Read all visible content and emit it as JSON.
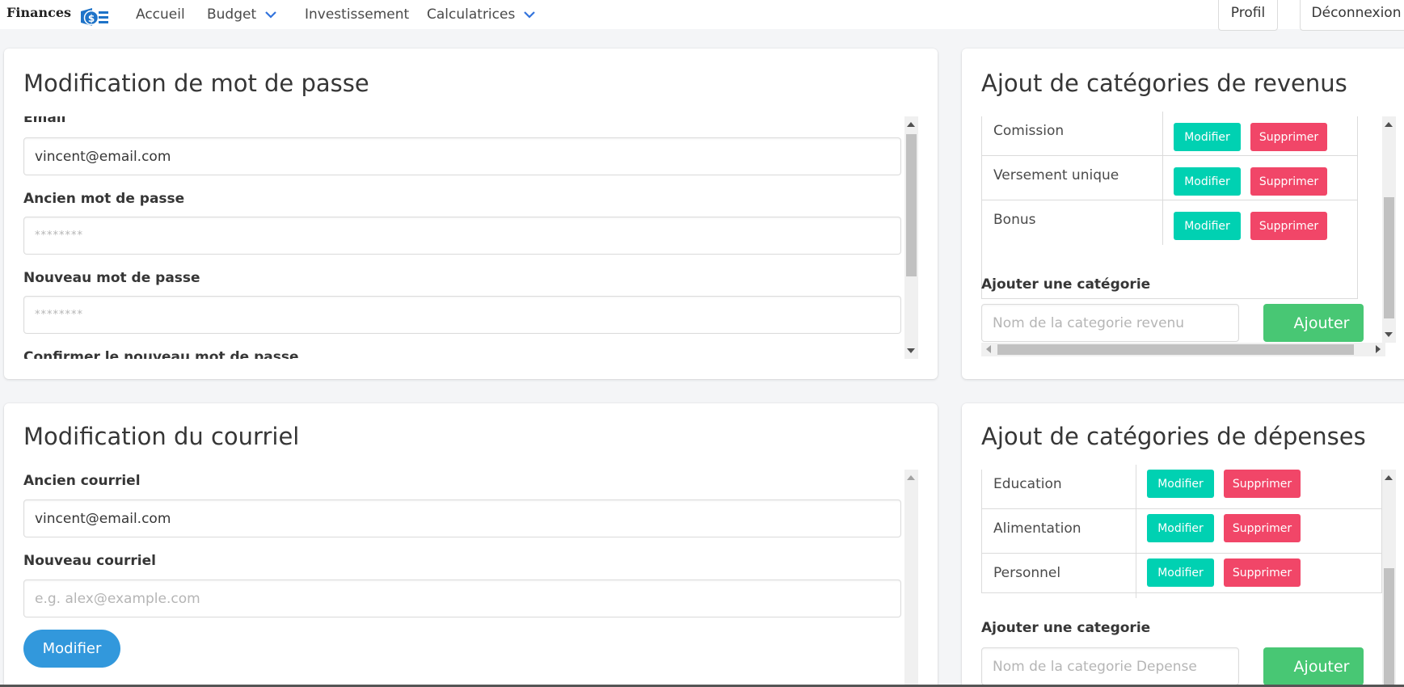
{
  "navbar": {
    "brand": "Finances",
    "items": [
      {
        "label": "Accueil"
      },
      {
        "label": "Budget"
      },
      {
        "label": "Investissement"
      },
      {
        "label": "Calculatrices"
      }
    ],
    "profile_label": "Profil",
    "logout_label": "Déconnexion"
  },
  "password_card": {
    "title": "Modification de mot de passe",
    "email_label": "Email",
    "email_value": "vincent@email.com",
    "old_label": "Ancien mot de passe",
    "old_placeholder": "********",
    "new_label": "Nouveau mot de passe",
    "new_placeholder": "********",
    "confirm_label": "Confirmer le nouveau mot de passe"
  },
  "email_card": {
    "title": "Modification du courriel",
    "old_label": "Ancien courriel",
    "old_value": "vincent@email.com",
    "new_label": "Nouveau courriel",
    "new_placeholder": "e.g. alex@example.com",
    "submit_label": "Modifier"
  },
  "revenue_card": {
    "title": "Ajout de catégories de revenus",
    "rows": [
      {
        "name": "Comission"
      },
      {
        "name": "Versement unique"
      },
      {
        "name": "Bonus"
      }
    ],
    "edit_label": "Modifier",
    "delete_label": "Supprimer",
    "add_label": "Ajouter une catégorie",
    "add_placeholder": "Nom de la categorie revenu",
    "add_button": "Ajouter"
  },
  "expense_card": {
    "title": "Ajout de catégories de dépenses",
    "rows": [
      {
        "name": "Education"
      },
      {
        "name": "Alimentation"
      },
      {
        "name": "Personnel"
      }
    ],
    "edit_label": "Modifier",
    "delete_label": "Supprimer",
    "add_label": "Ajouter une categorie",
    "add_placeholder": "Nom de la categorie Depense",
    "add_button": "Ajouter"
  },
  "colors": {
    "primary_blue": "#3298dc",
    "success_green": "#48c774",
    "teal": "#00d1b2",
    "danger_red": "#f14668"
  }
}
